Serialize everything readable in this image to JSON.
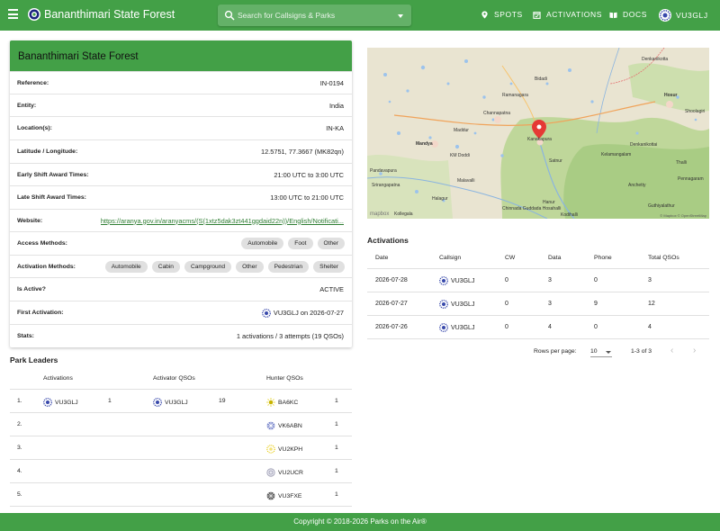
{
  "colors": {
    "brand": "#43a047",
    "link": "#2e7d32"
  },
  "header": {
    "title": "Bananthimari State Forest",
    "search_placeholder": "Search for Callsigns & Parks",
    "nav": {
      "spots": "SPOTS",
      "activations": "ACTIVATIONS",
      "docs": "DOCS",
      "user": "VU3GLJ"
    },
    "icons": [
      "menu-icon",
      "logo-icon",
      "search-icon",
      "location-pin-icon",
      "calendar-check-icon",
      "book-icon",
      "user-badge-icon"
    ]
  },
  "park": {
    "title": "Bananthimari State Forest",
    "reference": {
      "label": "Reference:",
      "value": "IN-0194"
    },
    "entity": {
      "label": "Entity:",
      "value": "India"
    },
    "location": {
      "label": "Location(s):",
      "value": "IN-KA"
    },
    "latlon": {
      "label": "Latitude / Longitude:",
      "value": "12.5751, 77.3667 (MK82qn)"
    },
    "early_shift": {
      "label": "Early Shift Award Times:",
      "value": "21:00 UTC to 3:00 UTC"
    },
    "late_shift": {
      "label": "Late Shift Award Times:",
      "value": "13:00 UTC to 21:00 UTC"
    },
    "website": {
      "label": "Website:",
      "value": "https://aranya.gov.in/aranyacms/(S(1xtz5dak3zt441ggdaid22n))/English/Notificati..."
    },
    "access_methods": {
      "label": "Access Methods:",
      "chips": [
        "Automobile",
        "Foot",
        "Other"
      ]
    },
    "activation_methods": {
      "label": "Activation Methods:",
      "chips": [
        "Automobile",
        "Cabin",
        "Campground",
        "Other",
        "Pedestrian",
        "Shelter"
      ]
    },
    "is_active": {
      "label": "Is Active?",
      "value": "ACTIVE"
    },
    "first_activation": {
      "label": "First Activation:",
      "callsign": "VU3GLJ",
      "suffix": "on 2026-07-27"
    },
    "stats": {
      "label": "Stats:",
      "value": "1 activations / 3 attempts (19 QSOs)"
    }
  },
  "leaders": {
    "title": "Park Leaders",
    "columns": [
      "Activations",
      "Activator QSOs",
      "Hunter QSOs"
    ],
    "rows": [
      {
        "rank": "1.",
        "act_call": "VU3GLJ",
        "act_count": "1",
        "aq_call": "VU3GLJ",
        "aq_count": "19",
        "hunter_call": "BA6KC",
        "hunter_count": "1"
      },
      {
        "rank": "2.",
        "hunter_call": "VK6ABN",
        "hunter_count": "1"
      },
      {
        "rank": "3.",
        "hunter_call": "VU2KPH",
        "hunter_count": "1"
      },
      {
        "rank": "4.",
        "hunter_call": "VU2UCR",
        "hunter_count": "1"
      },
      {
        "rank": "5.",
        "hunter_call": "VU3FXE",
        "hunter_count": "1"
      }
    ]
  },
  "map": {
    "towns": [
      "Bidadi",
      "Ramanagara",
      "Channapatna",
      "Kanakapura",
      "Maddur",
      "Mandya",
      "KM Doddi",
      "Malavalli",
      "Halagur",
      "Chinnada Guddada Hosahalli",
      "Kollegala",
      "Hanur",
      "Denkanikottai",
      "Hosur",
      "Shoolagiri",
      "Kelamangalam",
      "Thalli",
      "Anchetty",
      "Guthiyalathur",
      "Denkanikotta",
      "Pennagaram",
      "Pandavapura",
      "Srirangapatna",
      "Satnur",
      "Kodihalli"
    ],
    "brand": "mapbox",
    "attribution": "© Mapbox © OpenStreetMap"
  },
  "activations": {
    "title": "Activations",
    "columns": [
      "Date",
      "Callsign",
      "CW",
      "Data",
      "Phone",
      "Total QSOs"
    ],
    "rows": [
      {
        "date": "2026-07-28",
        "callsign": "VU3GLJ",
        "cw": "0",
        "data": "3",
        "phone": "0",
        "total": "3"
      },
      {
        "date": "2026-07-27",
        "callsign": "VU3GLJ",
        "cw": "0",
        "data": "3",
        "phone": "9",
        "total": "12"
      },
      {
        "date": "2026-07-26",
        "callsign": "VU3GLJ",
        "cw": "0",
        "data": "4",
        "phone": "0",
        "total": "4"
      }
    ],
    "rows_per_page_label": "Rows per page:",
    "rows_per_page": "10",
    "range": "1-3 of 3"
  },
  "footer": {
    "text": "Copyright © 2018-2026 Parks on the Air®"
  }
}
